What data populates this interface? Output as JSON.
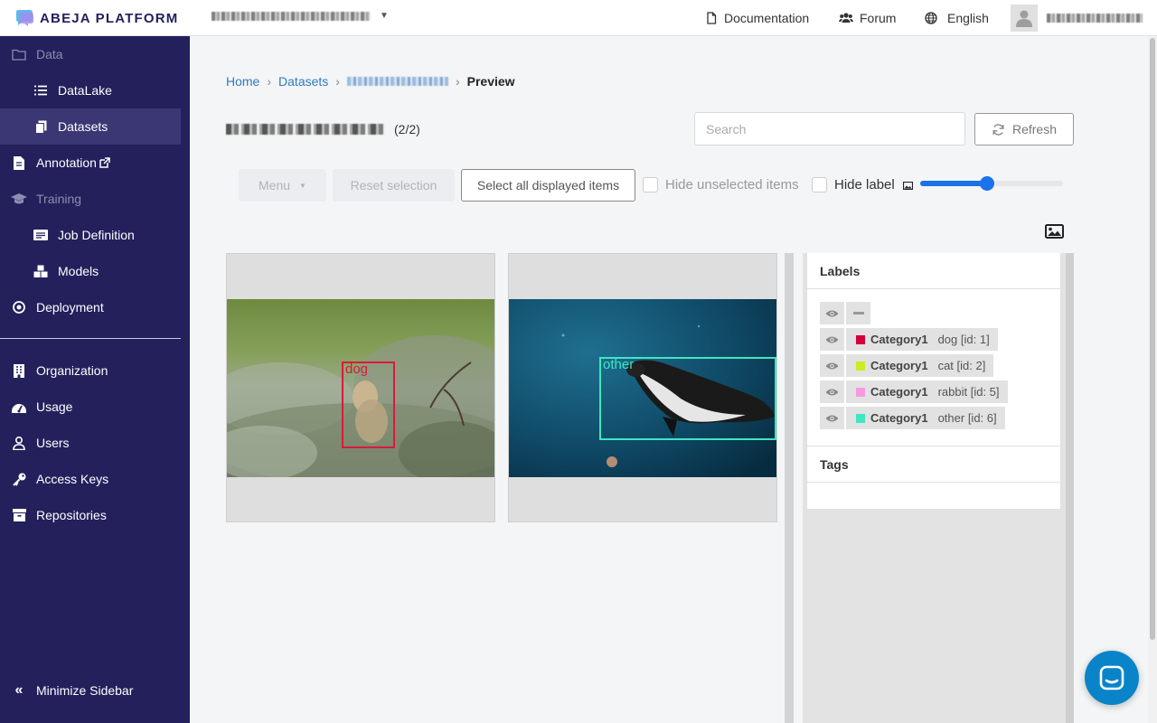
{
  "topbar": {
    "brand": "ABEJA PLATFORM",
    "documentation": "Documentation",
    "forum": "Forum",
    "language": "English"
  },
  "sidebar": {
    "data": "Data",
    "datalake": "DataLake",
    "datasets": "Datasets",
    "annotation": "Annotation",
    "training": "Training",
    "job_definition": "Job Definition",
    "models": "Models",
    "deployment": "Deployment",
    "organization": "Organization",
    "usage": "Usage",
    "users": "Users",
    "access_keys": "Access Keys",
    "repositories": "Repositories",
    "minimize": "Minimize Sidebar"
  },
  "breadcrumb": {
    "home": "Home",
    "datasets": "Datasets",
    "current": "Preview"
  },
  "dataset": {
    "count": "(2/2)"
  },
  "search": {
    "placeholder": "Search"
  },
  "refresh_label": "Refresh",
  "toolbar": {
    "menu": "Menu",
    "reset_selection": "Reset selection",
    "select_all": "Select all displayed items",
    "hide_unselected": "Hide unselected items",
    "hide_label": "Hide label",
    "image_size_level": 0.47
  },
  "cards": [
    {
      "box_label": "dog",
      "box_color": "#d81b3c"
    },
    {
      "box_label": "other",
      "box_color": "#3ee6c1"
    }
  ],
  "labels_panel": {
    "title": "Labels",
    "tags_title": "Tags",
    "items": [
      {
        "category": "Category1",
        "name": "dog [id: 1]",
        "color": "#d4003a"
      },
      {
        "category": "Category1",
        "name": "cat [id: 2]",
        "color": "#c8ee23"
      },
      {
        "category": "Category1",
        "name": "rabbit [id: 5]",
        "color": "#f59be0"
      },
      {
        "category": "Category1",
        "name": "other [id: 6]",
        "color": "#3ee6c1"
      }
    ]
  },
  "colors": {
    "sidebar_bg": "#23205c",
    "link": "#2d7bc0",
    "slider": "#1a73e8",
    "chat_button": "#0a84c8"
  }
}
